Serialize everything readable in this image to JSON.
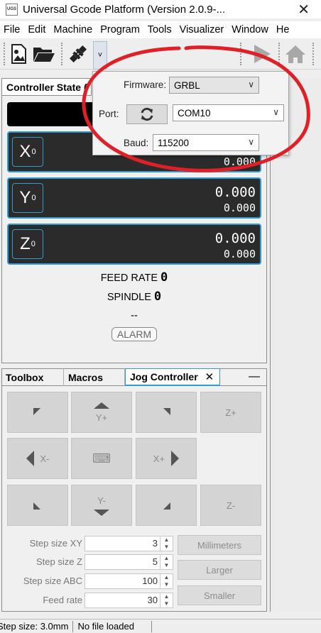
{
  "window": {
    "title": "Universal Gcode Platform (Version 2.0.9-...",
    "icon_text": "UGS",
    "close_glyph": "✕"
  },
  "menu": [
    "File",
    "Edit",
    "Machine",
    "Program",
    "Tools",
    "Visualizer",
    "Window",
    "He"
  ],
  "toolbar": {
    "dropdown_glyph": "˅"
  },
  "controller": {
    "title": "Controller State ("
  },
  "axes": [
    {
      "letter": "X",
      "sub": "0",
      "work": "",
      "machine": "0.000"
    },
    {
      "letter": "Y",
      "sub": "0",
      "work": "0.000",
      "machine": "0.000"
    },
    {
      "letter": "Z",
      "sub": "0",
      "work": "0.000",
      "machine": "0.000"
    }
  ],
  "feed": {
    "label": "FEED RATE",
    "value": "0"
  },
  "spindle": {
    "label": "SPINDLE",
    "value": "0"
  },
  "pin_state": "--",
  "alarm_label": "ALARM",
  "tabs": {
    "toolbox": "Toolbox",
    "macros": "Macros",
    "jog": "Jog Controller",
    "close": "✕",
    "minimize": "—"
  },
  "jog_buttons": {
    "y_plus": "Y+",
    "y_minus": "Y-",
    "x_minus": "X-",
    "x_plus": "X+",
    "z_plus": "Z+",
    "z_minus": "Z-",
    "keyboard": "⌨"
  },
  "step_fields": [
    {
      "label": "Step size XY",
      "value": "3"
    },
    {
      "label": "Step size Z",
      "value": "5"
    },
    {
      "label": "Step size ABC",
      "value": "100"
    },
    {
      "label": "Feed rate",
      "value": "30"
    }
  ],
  "side_buttons": {
    "units": "Millimeters",
    "larger": "Larger",
    "smaller": "Smaller"
  },
  "status": {
    "step": "Step size: 3.0mm",
    "file": "No file loaded"
  },
  "connection": {
    "firmware_label": "Firmware:",
    "firmware": "GRBL",
    "port_label": "Port:",
    "port": "COM10",
    "baud_label": "Baud:",
    "baud": "115200",
    "chevron": "∨"
  },
  "colors": {
    "accent": "#2f9bd5",
    "annotation": "#e01f26",
    "dro_background": "#2b2b2b"
  }
}
